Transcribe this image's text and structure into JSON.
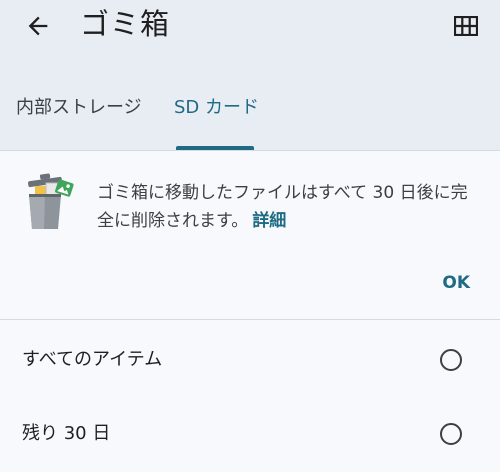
{
  "app_bar": {
    "title": "ゴミ箱",
    "back_icon": "arrow-back-icon",
    "grid_icon": "grid-view-icon"
  },
  "tabs": [
    {
      "label": "内部ストレージ",
      "selected": false
    },
    {
      "label": "SD カード",
      "selected": true
    }
  ],
  "banner": {
    "message": "ゴミ箱に移動したファイルはすべて 30 日後に完全に削除されます。",
    "link_label": "詳細",
    "ok_label": "OK",
    "icon": "trash-bin-icon"
  },
  "list": {
    "items": [
      {
        "label": "すべてのアイテム",
        "selected": false
      },
      {
        "label": "残り 30 日",
        "selected": false
      }
    ]
  },
  "colors": {
    "accent": "#1f6a85",
    "header_bg": "#e8edf4",
    "surface": "#f7f9fc"
  }
}
